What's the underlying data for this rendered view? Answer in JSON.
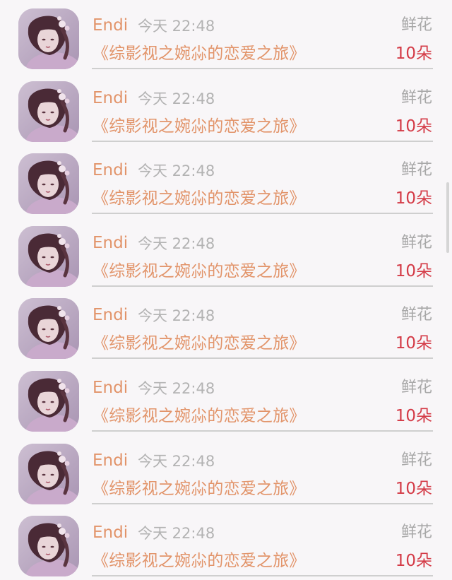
{
  "items": [
    {
      "name": "Endi",
      "time": "今天 22:48",
      "kind": "鲜花",
      "title": "《综影视之婉尛的恋爱之旅》",
      "count": "10朵"
    },
    {
      "name": "Endi",
      "time": "今天 22:48",
      "kind": "鲜花",
      "title": "《综影视之婉尛的恋爱之旅》",
      "count": "10朵"
    },
    {
      "name": "Endi",
      "time": "今天 22:48",
      "kind": "鲜花",
      "title": "《综影视之婉尛的恋爱之旅》",
      "count": "10朵"
    },
    {
      "name": "Endi",
      "time": "今天 22:48",
      "kind": "鲜花",
      "title": "《综影视之婉尛的恋爱之旅》",
      "count": "10朵"
    },
    {
      "name": "Endi",
      "time": "今天 22:48",
      "kind": "鲜花",
      "title": "《综影视之婉尛的恋爱之旅》",
      "count": "10朵"
    },
    {
      "name": "Endi",
      "time": "今天 22:48",
      "kind": "鲜花",
      "title": "《综影视之婉尛的恋爱之旅》",
      "count": "10朵"
    },
    {
      "name": "Endi",
      "time": "今天 22:48",
      "kind": "鲜花",
      "title": "《综影视之婉尛的恋爱之旅》",
      "count": "10朵"
    },
    {
      "name": "Endi",
      "time": "今天 22:48",
      "kind": "鲜花",
      "title": "《综影视之婉尛的恋爱之旅》",
      "count": "10朵"
    }
  ],
  "colors": {
    "name": "#e2946a",
    "title": "#e2946a",
    "time": "#b3b3b3",
    "kind": "#a8a8a8",
    "count": "#d43b47",
    "divider": "#cfcfcf",
    "background": "#f8f6f8"
  },
  "avatar_icon": "avatar-portrait-illustration"
}
